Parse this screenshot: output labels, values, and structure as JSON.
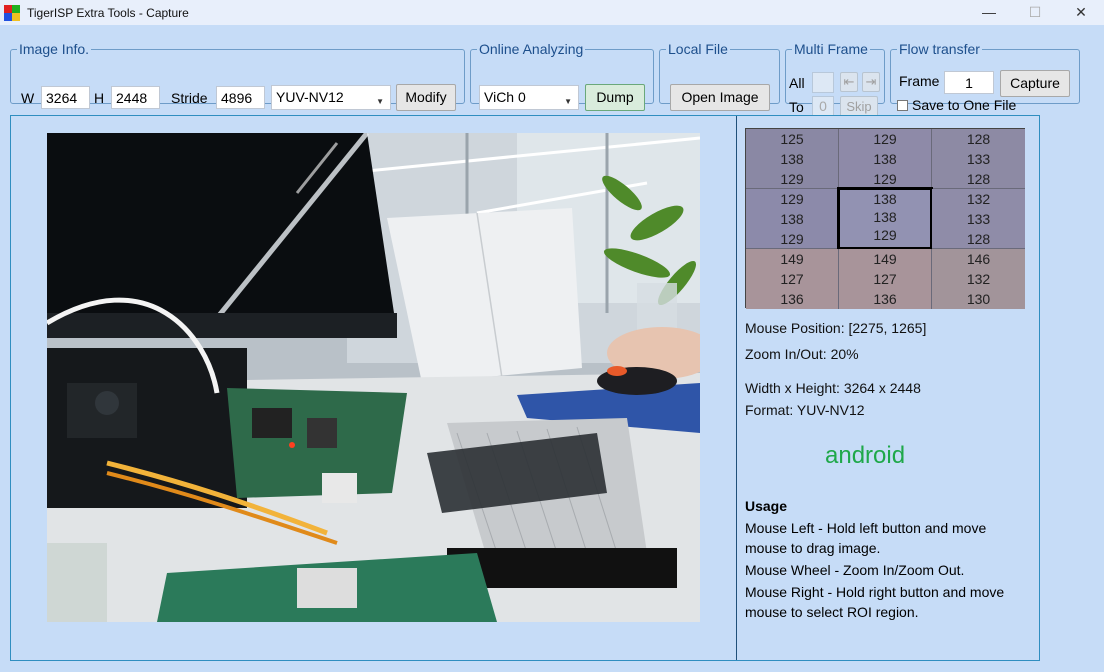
{
  "window": {
    "title": "TigerISP Extra Tools - Capture",
    "minimize": "—",
    "maximize": "☐",
    "close": "✕"
  },
  "image_info": {
    "legend": "Image Info.",
    "w_label": "W",
    "w_value": "3264",
    "h_label": "H",
    "h_value": "2448",
    "stride_label": "Stride",
    "stride_value": "4896",
    "format_value": "YUV-NV12",
    "modify_label": "Modify"
  },
  "online": {
    "legend": "Online Analyzing",
    "channel_value": "ViCh 0",
    "dump_label": "Dump"
  },
  "local_file": {
    "legend": "Local File",
    "open_label": "Open Image"
  },
  "multi_frame": {
    "legend": "Multi Frame",
    "all_label": "All",
    "to_label": "To",
    "to_value": "0",
    "prev_label": "⇤",
    "next_label": "⇥",
    "skip_label": "Skip"
  },
  "flow": {
    "legend": "Flow transfer",
    "frame_label": "Frame",
    "frame_value": "1",
    "capture_label": "Capture",
    "save_label": "Save to One File"
  },
  "pixel_grid": [
    [
      [
        "125",
        "138",
        "129"
      ],
      [
        "129",
        "138",
        "129"
      ],
      [
        "128",
        "133",
        "128"
      ]
    ],
    [
      [
        "129",
        "138",
        "129"
      ],
      [
        "138",
        "138",
        "129"
      ],
      [
        "132",
        "133",
        "128"
      ]
    ],
    [
      [
        "149",
        "127",
        "136"
      ],
      [
        "149",
        "127",
        "136"
      ],
      [
        "146",
        "132",
        "130"
      ]
    ]
  ],
  "pixel_colors": [
    [
      "#8a88a4",
      "#8e8aa8",
      "#8d8aa4"
    ],
    [
      "#8c8aaa",
      "#9292b2",
      "#8f8ca8"
    ],
    [
      "#a8949a",
      "#a8949a",
      "#a2949a"
    ]
  ],
  "info": {
    "mouse_position": "Mouse Position: [2275, 1265]",
    "zoom": "Zoom In/Out: 20%",
    "size": "Width x Height: 3264 x 2448",
    "format": "Format: YUV-NV12",
    "android": "android"
  },
  "usage": {
    "title": "Usage",
    "line1a": "Mouse Left - Hold left button and move",
    "line1b": "mouse to drag image.",
    "line2": "Mouse Wheel - Zoom In/Zoom Out.",
    "line3a": "Mouse Right - Hold right button and move",
    "line3b": "mouse to select ROI region."
  }
}
